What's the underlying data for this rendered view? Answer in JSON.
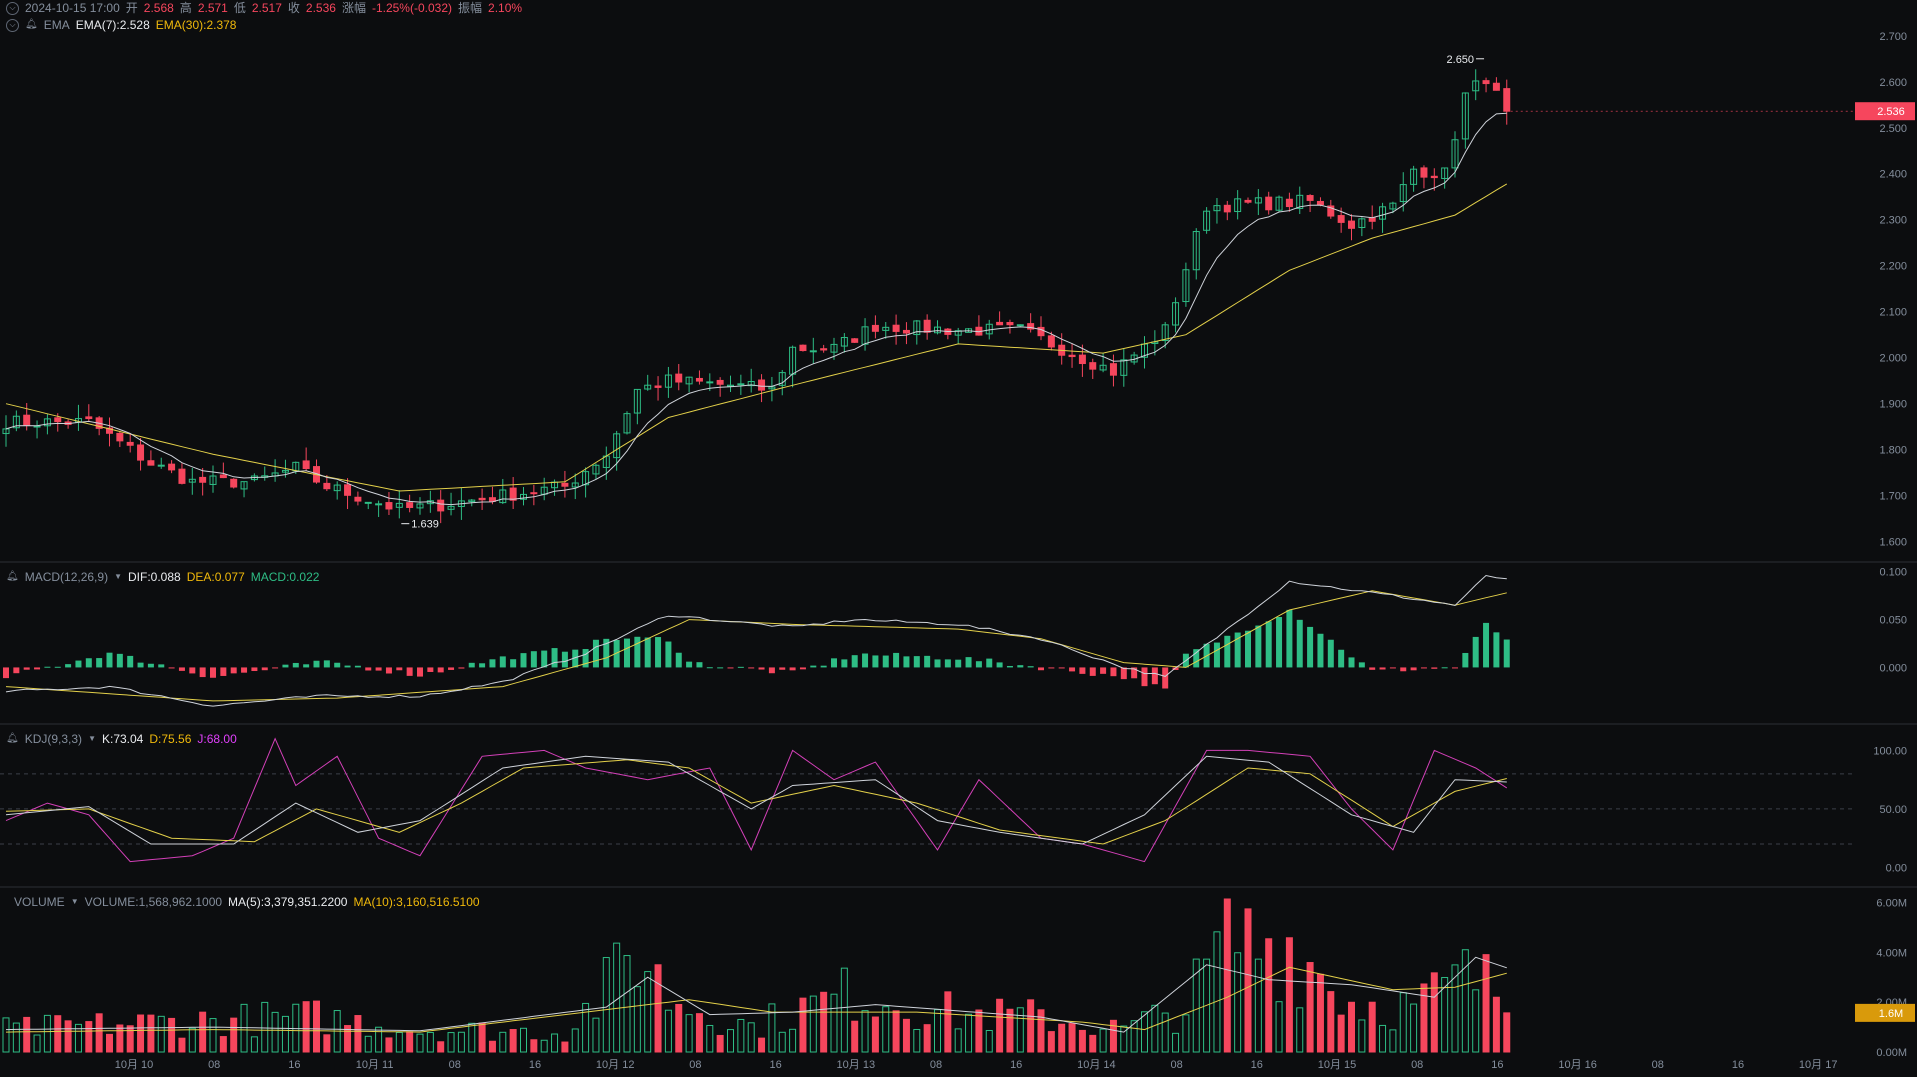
{
  "header": {
    "datetime": "2024-10-15 17:00",
    "open_label": "开",
    "open": "2.568",
    "high_label": "高",
    "high": "2.571",
    "low_label": "低",
    "low": "2.517",
    "close_label": "收",
    "close": "2.536",
    "change_label": "涨幅",
    "change": "-1.25%(-0.032)",
    "amplitude_label": "振幅",
    "amplitude": "2.10%"
  },
  "indicators": {
    "ema": {
      "name": "EMA",
      "ema7": "EMA(7):2.528",
      "ema30": "EMA(30):2.378"
    },
    "macd": {
      "name": "MACD(12,26,9)",
      "dif": "DIF:0.088",
      "dea": "DEA:0.077",
      "macd": "MACD:0.022"
    },
    "kdj": {
      "name": "KDJ(9,3,3)",
      "k": "K:73.04",
      "d": "D:75.56",
      "j": "J:68.00"
    },
    "volume": {
      "name": "VOLUME",
      "vol": "VOLUME:1,568,962.1000",
      "ma5": "MA(5):3,379,351.2200",
      "ma10": "MA(10):3,160,516.5100"
    }
  },
  "colors": {
    "up": "#2ebd85",
    "down": "#f6465d",
    "ema7": "#cfd3da",
    "ema30": "#e3d04a",
    "kdj_j": "#d340b8",
    "grid": "#2b2f36",
    "background": "#0c0d0f"
  },
  "chart_data": [
    {
      "type": "candlestick",
      "title": "",
      "ylim": [
        1.56,
        2.73
      ],
      "y_ticks": [
        "1.600",
        "1.700",
        "1.800",
        "1.900",
        "2.000",
        "2.100",
        "2.200",
        "2.300",
        "2.400",
        "2.500",
        "2.600",
        "2.700"
      ],
      "x_ticks": [
        "10月 10",
        "08",
        "16",
        "10月 11",
        "08",
        "16",
        "10月 12",
        "08",
        "16",
        "10月 13",
        "08",
        "16",
        "10月 14",
        "08",
        "16",
        "10月 15",
        "08",
        "16",
        "10月 16",
        "08",
        "16",
        "10月 17"
      ],
      "current_price_label": "2.536",
      "high_annotation": "2.650",
      "low_annotation": "1.639",
      "anchors": [
        [
          0,
          1.86
        ],
        [
          8,
          1.86
        ],
        [
          14,
          1.77
        ],
        [
          18,
          1.73
        ],
        [
          24,
          1.73
        ],
        [
          28,
          1.76
        ],
        [
          31,
          1.72
        ],
        [
          38,
          1.67
        ],
        [
          42,
          1.68
        ],
        [
          48,
          1.7
        ],
        [
          54,
          1.72
        ],
        [
          58,
          1.79
        ],
        [
          61,
          1.93
        ],
        [
          64,
          1.95
        ],
        [
          70,
          1.94
        ],
        [
          74,
          1.93
        ],
        [
          76,
          2.02
        ],
        [
          80,
          2.02
        ],
        [
          84,
          2.07
        ],
        [
          92,
          2.06
        ],
        [
          98,
          2.06
        ],
        [
          104,
          2.0
        ],
        [
          107,
          1.97
        ],
        [
          112,
          2.06
        ],
        [
          116,
          2.33
        ],
        [
          126,
          2.34
        ],
        [
          130,
          2.29
        ],
        [
          134,
          2.33
        ],
        [
          136,
          2.41
        ],
        [
          139,
          2.4
        ],
        [
          141,
          2.57
        ],
        [
          143,
          2.61
        ],
        [
          145,
          2.53
        ]
      ],
      "ema30_anchors": [
        [
          0,
          1.9
        ],
        [
          20,
          1.79
        ],
        [
          38,
          1.71
        ],
        [
          54,
          1.73
        ],
        [
          64,
          1.87
        ],
        [
          76,
          1.94
        ],
        [
          92,
          2.03
        ],
        [
          106,
          2.01
        ],
        [
          114,
          2.05
        ],
        [
          124,
          2.19
        ],
        [
          132,
          2.26
        ],
        [
          140,
          2.31
        ],
        [
          145,
          2.378
        ]
      ]
    },
    {
      "type": "bar+line",
      "title": "MACD(12,26,9)",
      "ylim": [
        -0.057,
        0.107
      ],
      "y_ticks": [
        "0.000",
        "0.050",
        "0.100"
      ],
      "dif_anchors": [
        [
          0,
          -0.025
        ],
        [
          10,
          -0.02
        ],
        [
          20,
          -0.04
        ],
        [
          30,
          -0.03
        ],
        [
          40,
          -0.03
        ],
        [
          48,
          -0.015
        ],
        [
          56,
          0.015
        ],
        [
          64,
          0.055
        ],
        [
          70,
          0.048
        ],
        [
          76,
          0.042
        ],
        [
          82,
          0.05
        ],
        [
          92,
          0.045
        ],
        [
          100,
          0.03
        ],
        [
          108,
          0.0
        ],
        [
          112,
          -0.01
        ],
        [
          118,
          0.04
        ],
        [
          124,
          0.09
        ],
        [
          134,
          0.075
        ],
        [
          140,
          0.065
        ],
        [
          143,
          0.095
        ],
        [
          145,
          0.093
        ]
      ],
      "dea_anchors": [
        [
          0,
          -0.02
        ],
        [
          20,
          -0.035
        ],
        [
          32,
          -0.032
        ],
        [
          48,
          -0.02
        ],
        [
          58,
          0.01
        ],
        [
          66,
          0.05
        ],
        [
          76,
          0.045
        ],
        [
          92,
          0.04
        ],
        [
          100,
          0.03
        ],
        [
          108,
          0.005
        ],
        [
          114,
          0.0
        ],
        [
          124,
          0.06
        ],
        [
          132,
          0.08
        ],
        [
          140,
          0.065
        ],
        [
          145,
          0.078
        ]
      ]
    },
    {
      "type": "line",
      "title": "KDJ(9,3,3)",
      "ylim": [
        -15,
        120
      ],
      "y_ticks": [
        "0.00",
        "50.00",
        "100.00"
      ],
      "k_anchors": [
        [
          0,
          45
        ],
        [
          8,
          52
        ],
        [
          14,
          20
        ],
        [
          22,
          20
        ],
        [
          28,
          55
        ],
        [
          34,
          30
        ],
        [
          40,
          40
        ],
        [
          48,
          85
        ],
        [
          56,
          95
        ],
        [
          64,
          90
        ],
        [
          72,
          50
        ],
        [
          76,
          70
        ],
        [
          84,
          75
        ],
        [
          90,
          40
        ],
        [
          96,
          30
        ],
        [
          104,
          20
        ],
        [
          110,
          45
        ],
        [
          116,
          95
        ],
        [
          122,
          90
        ],
        [
          130,
          45
        ],
        [
          136,
          30
        ],
        [
          140,
          75
        ],
        [
          145,
          73
        ]
      ],
      "d_anchors": [
        [
          0,
          48
        ],
        [
          8,
          50
        ],
        [
          16,
          25
        ],
        [
          24,
          22
        ],
        [
          30,
          50
        ],
        [
          38,
          30
        ],
        [
          44,
          55
        ],
        [
          50,
          85
        ],
        [
          60,
          92
        ],
        [
          66,
          85
        ],
        [
          72,
          55
        ],
        [
          80,
          70
        ],
        [
          88,
          55
        ],
        [
          96,
          32
        ],
        [
          106,
          20
        ],
        [
          112,
          40
        ],
        [
          120,
          85
        ],
        [
          126,
          80
        ],
        [
          134,
          35
        ],
        [
          140,
          65
        ],
        [
          145,
          76
        ]
      ],
      "j_anchors": [
        [
          0,
          40
        ],
        [
          4,
          55
        ],
        [
          8,
          45
        ],
        [
          12,
          5
        ],
        [
          18,
          10
        ],
        [
          22,
          25
        ],
        [
          26,
          110
        ],
        [
          28,
          70
        ],
        [
          32,
          95
        ],
        [
          36,
          25
        ],
        [
          40,
          10
        ],
        [
          46,
          95
        ],
        [
          52,
          100
        ],
        [
          56,
          85
        ],
        [
          62,
          75
        ],
        [
          68,
          85
        ],
        [
          72,
          15
        ],
        [
          76,
          100
        ],
        [
          80,
          75
        ],
        [
          84,
          90
        ],
        [
          90,
          15
        ],
        [
          94,
          75
        ],
        [
          100,
          25
        ],
        [
          104,
          20
        ],
        [
          110,
          5
        ],
        [
          116,
          100
        ],
        [
          120,
          100
        ],
        [
          126,
          95
        ],
        [
          130,
          50
        ],
        [
          134,
          15
        ],
        [
          138,
          100
        ],
        [
          142,
          85
        ],
        [
          145,
          68
        ]
      ]
    },
    {
      "type": "bar+line",
      "title": "VOLUME",
      "ylim": [
        0,
        6.5
      ],
      "y_ticks": [
        "0.00M",
        "2.00M",
        "4.00M",
        "6.00M"
      ],
      "current_volume_label": "1.6M",
      "volume_anchors": [
        [
          0,
          0.9
        ],
        [
          16,
          1.2
        ],
        [
          30,
          1.4
        ],
        [
          40,
          0.9
        ],
        [
          54,
          0.8
        ],
        [
          58,
          2.5
        ],
        [
          61,
          4.2
        ],
        [
          64,
          2.2
        ],
        [
          72,
          1.0
        ],
        [
          76,
          1.6
        ],
        [
          82,
          2.4
        ],
        [
          92,
          1.5
        ],
        [
          100,
          1.4
        ],
        [
          108,
          0.9
        ],
        [
          114,
          1.8
        ],
        [
          118,
          4.5
        ],
        [
          124,
          4.3
        ],
        [
          130,
          2.0
        ],
        [
          136,
          1.8
        ],
        [
          141,
          3.0
        ],
        [
          145,
          2.4
        ]
      ],
      "ma5_anchors": [
        [
          0,
          0.9
        ],
        [
          20,
          1.0
        ],
        [
          40,
          0.85
        ],
        [
          58,
          1.8
        ],
        [
          62,
          3.0
        ],
        [
          68,
          1.5
        ],
        [
          76,
          1.6
        ],
        [
          84,
          1.9
        ],
        [
          100,
          1.4
        ],
        [
          108,
          0.8
        ],
        [
          116,
          3.5
        ],
        [
          122,
          2.9
        ],
        [
          130,
          2.7
        ],
        [
          138,
          2.2
        ],
        [
          142,
          3.8
        ],
        [
          145,
          3.38
        ]
      ],
      "ma10_anchors": [
        [
          0,
          0.8
        ],
        [
          20,
          0.9
        ],
        [
          40,
          0.8
        ],
        [
          60,
          1.8
        ],
        [
          66,
          2.1
        ],
        [
          74,
          1.6
        ],
        [
          88,
          1.6
        ],
        [
          104,
          1.2
        ],
        [
          110,
          0.9
        ],
        [
          118,
          2.2
        ],
        [
          124,
          3.4
        ],
        [
          134,
          2.5
        ],
        [
          140,
          2.6
        ],
        [
          145,
          3.16
        ]
      ]
    }
  ]
}
